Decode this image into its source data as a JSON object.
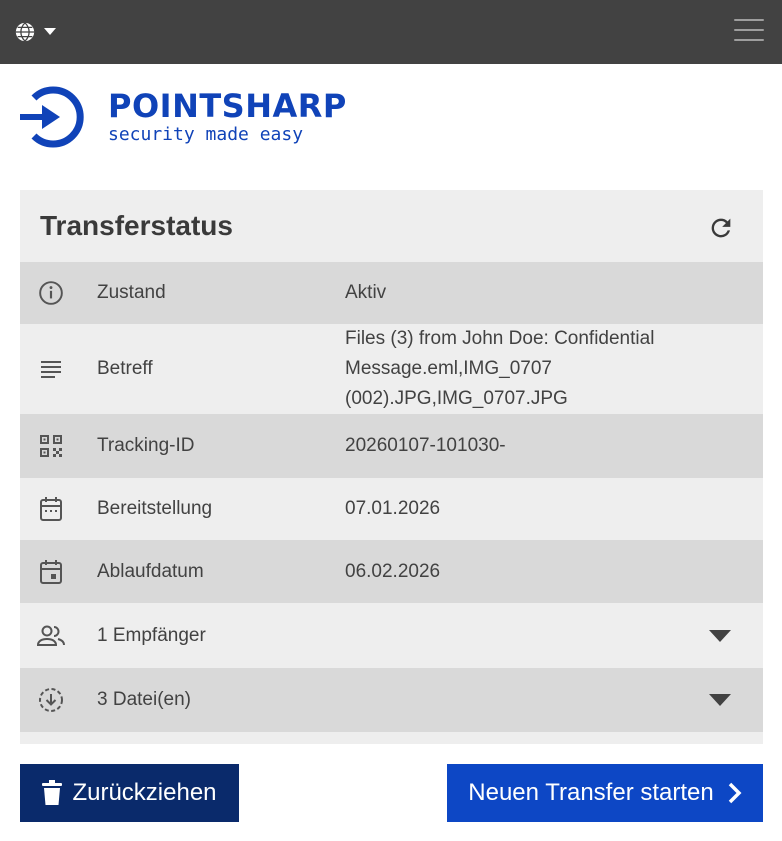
{
  "colors": {
    "topbar": "#424242",
    "brand": "#1043b8",
    "panel": "#eeeeee",
    "row_dark": "#d9d9d9",
    "btn_withdraw": "#0a2a6b",
    "btn_new": "#0d47c5"
  },
  "topbar": {
    "lang_icon": "globe-icon",
    "lang_caret": "caret-down-icon",
    "menu_icon": "hamburger-icon"
  },
  "logo": {
    "title": "POINTSHARP",
    "subtitle": "security made easy"
  },
  "panel": {
    "title": "Transferstatus",
    "refresh_icon": "refresh-icon",
    "rows": [
      {
        "icon": "info-icon",
        "label": "Zustand",
        "value": "Aktiv"
      },
      {
        "icon": "subject-icon",
        "label": "Betreff",
        "value": "Files (3) from John Doe: Confidential Message.eml,IMG_0707 (002).JPG,IMG_0707.JPG"
      },
      {
        "icon": "qr-code-icon",
        "label": "Tracking-ID",
        "value": "20260107-101030-"
      },
      {
        "icon": "calendar-icon",
        "label": "Bereitstellung",
        "value": "07.01.2026"
      },
      {
        "icon": "event-icon",
        "label": "Ablaufdatum",
        "value": "06.02.2026"
      },
      {
        "icon": "people-icon",
        "label": "1 Empfänger"
      },
      {
        "icon": "download-circle-icon",
        "label": "3 Datei(en)"
      }
    ]
  },
  "actions": {
    "withdraw_label": "Zurückziehen",
    "withdraw_icon": "trash-icon",
    "new_label": "Neuen Transfer starten",
    "new_icon": "chevron-right-icon"
  }
}
